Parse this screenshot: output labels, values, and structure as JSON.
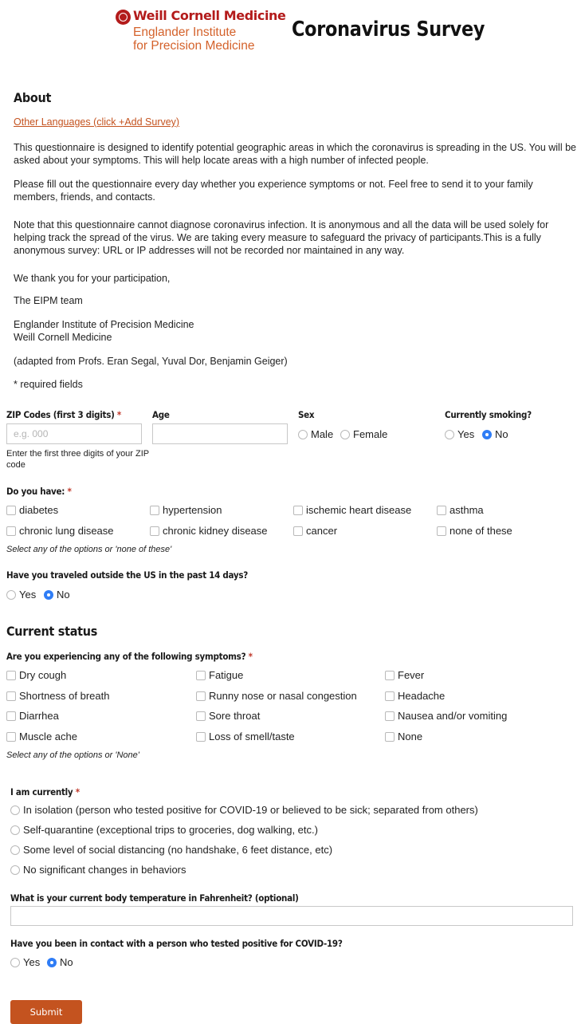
{
  "header": {
    "logo_line1": "Weill Cornell Medicine",
    "logo_line2": "Englander Institute",
    "logo_line3": "for Precision Medicine",
    "title": "Coronavirus Survey"
  },
  "about": {
    "heading": "About",
    "languages_link": "Other Languages (click +Add Survey)",
    "p1": "This questionnaire is designed to identify potential geographic areas in which the coronavirus is spreading in the US. You will be asked about your symptoms. This will help locate areas with a high number of infected people.",
    "p2": "Please fill out the questionnaire every day whether you experience symptoms or not. Feel free to send it to your family members, friends, and contacts.",
    "p3": "Note that this questionnaire cannot diagnose coronavirus infection. It is anonymous and all the data will be used solely for helping track the spread of the virus. We are taking every measure to safeguard the privacy of participants.This is a fully anonymous survey: URL or IP addresses will not be recorded nor maintained in any way.",
    "p4": "We thank you for your participation,",
    "p5": "The EIPM team",
    "p6a": "Englander Institute of Precision Medicine",
    "p6b": "Weill Cornell Medicine",
    "p7": "(adapted from Profs. Eran Segal, Yuval Dor, Benjamin Geiger)",
    "p8": "* required fields"
  },
  "demographics": {
    "zip_label": "ZIP Codes (first 3 digits)",
    "zip_placeholder": "e.g. 000",
    "zip_hint": "Enter the first three digits of your ZIP code",
    "age_label": "Age",
    "sex_label": "Sex",
    "sex_options": [
      "Male",
      "Female"
    ],
    "smoking_label": "Currently smoking?",
    "smoking_options": [
      "Yes",
      "No"
    ],
    "smoking_selected": "No",
    "required_mark": "*"
  },
  "conditions": {
    "label": "Do you have:",
    "options": [
      "diabetes",
      "hypertension",
      "ischemic heart disease",
      "asthma",
      "chronic lung disease",
      "chronic kidney disease",
      "cancer",
      "none of these"
    ],
    "hint": "Select any of the options or 'none of these'"
  },
  "travel": {
    "label": "Have you traveled outside the US in the past 14 days?",
    "options": [
      "Yes",
      "No"
    ],
    "selected": "No"
  },
  "status": {
    "heading": "Current status",
    "symptoms_label": "Are you experiencing any of the following symptoms?",
    "symptoms": [
      "Dry cough",
      "Fatigue",
      "Fever",
      "Shortness of breath",
      "Runny nose or nasal congestion",
      "Headache",
      "Diarrhea",
      "Sore throat",
      "Nausea and/or vomiting",
      "Muscle ache",
      "Loss of smell/taste",
      "None"
    ],
    "symptoms_hint": "Select any of the options or 'None'",
    "currently_label": "I am currently",
    "currently_options": [
      "In isolation (person who tested positive for COVID-19 or believed to be sick; separated from others)",
      "Self-quarantine (exceptional trips to groceries, dog walking, etc.)",
      "Some level of social distancing (no handshake, 6 feet distance, etc)",
      "No significant changes in behaviors"
    ],
    "temp_label": "What is your current body temperature in Fahrenheit? (optional)",
    "contact_label": "Have you been in contact with a person who tested positive for COVID-19?",
    "contact_options": [
      "Yes",
      "No"
    ],
    "contact_selected": "No"
  },
  "submit_label": "Submit",
  "colors": {
    "accent": "#c4531f",
    "brand_red": "#b31b1b",
    "radio_selected": "#2f7df6"
  }
}
